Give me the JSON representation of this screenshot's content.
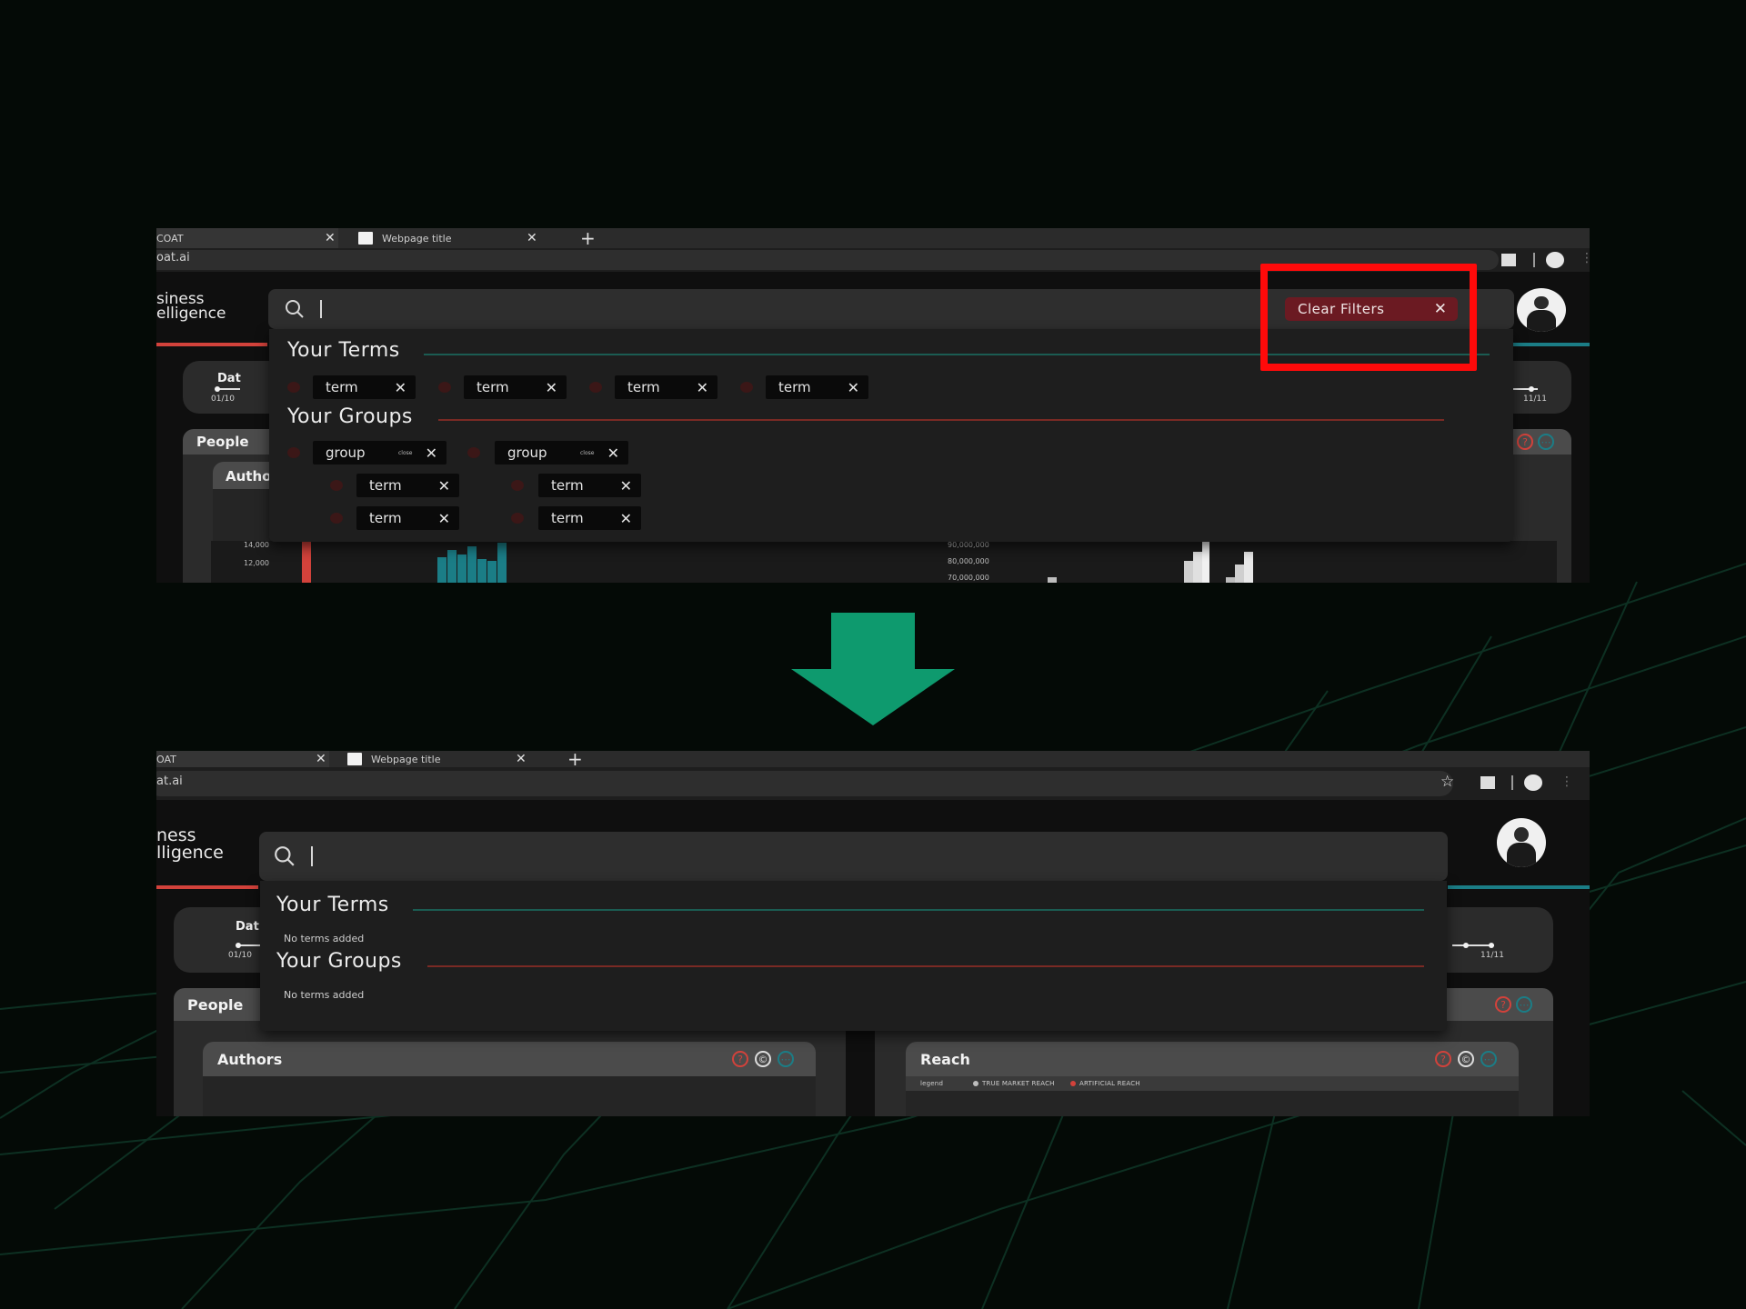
{
  "browser_top": {
    "tab1_title": "COAT",
    "tab2_title": "Webpage title",
    "url": "oat.ai"
  },
  "browser_bottom": {
    "tab1_title": "OAT",
    "tab2_title": "Webpage title",
    "url": "at.ai"
  },
  "brand_top": [
    "siness",
    "elligence"
  ],
  "brand_bottom": [
    "ness",
    "lligence"
  ],
  "search": {
    "clear_filters_label": "Clear Filters"
  },
  "dropdown_before": {
    "terms_title": "Your Terms",
    "terms": [
      "term",
      "term",
      "term",
      "term"
    ],
    "groups_title": "Your Groups",
    "groups": [
      {
        "label": "group",
        "badge": "close",
        "terms": [
          "term",
          "term"
        ]
      },
      {
        "label": "group",
        "badge": "close",
        "terms": [
          "term",
          "term"
        ]
      }
    ]
  },
  "dropdown_after": {
    "terms_title": "Your Terms",
    "terms_empty": "No terms added",
    "groups_title": "Your Groups",
    "groups_empty": "No terms added"
  },
  "panels": {
    "date_label": "Dat",
    "date_start": "01/10",
    "date_end": "11/11",
    "people_title": "People",
    "authors_title": "Authors",
    "authors_title_truncated": "Autho",
    "reach_title": "Reach",
    "left_ticks": [
      "14,000",
      "12,000"
    ],
    "right_ticks": [
      "90,000,000",
      "80,000,000",
      "70,000,000"
    ],
    "legend_label": "legend",
    "legend_items": [
      "TRUE MARKET REACH",
      "ARTIFICIAL REACH"
    ]
  },
  "colors": {
    "accent_red": "#d2423b",
    "accent_teal": "#1b7d86",
    "clear_chip": "#6b1a22",
    "highlight": "#ff0a0a",
    "arrow": "#0e9a6e"
  },
  "icons": [
    "search-icon",
    "close-icon",
    "help-icon",
    "copy-icon",
    "more-icon",
    "star-icon",
    "down-arrow-icon"
  ]
}
